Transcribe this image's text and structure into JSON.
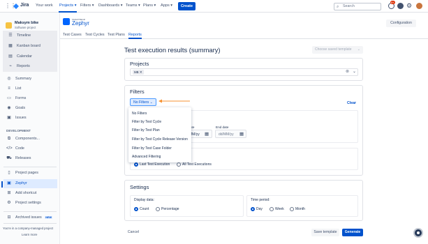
{
  "topnav": {
    "logo": "Jira",
    "your_work": "Your work",
    "projects": "Projects",
    "filters": "Filters",
    "dashboards": "Dashboards",
    "teams": "Teams",
    "plans": "Plans",
    "apps": "Apps",
    "create": "Create",
    "search_placeholder": "Search",
    "notification_count": "9+"
  },
  "sidebar": {
    "project_name": "Maksym bike",
    "project_type": "Software project",
    "planning_items": [
      {
        "label": "Timeline",
        "icon": "timeline-icon"
      },
      {
        "label": "Kanban board",
        "icon": "board-icon"
      },
      {
        "label": "Calendar",
        "icon": "calendar-icon"
      },
      {
        "label": "Reports",
        "icon": "reports-icon"
      }
    ],
    "items": [
      {
        "label": "Summary",
        "icon": "globe-icon"
      },
      {
        "label": "List",
        "icon": "list-icon"
      },
      {
        "label": "Forms",
        "icon": "forms-icon"
      },
      {
        "label": "Goals",
        "icon": "goals-icon"
      },
      {
        "label": "Issues",
        "icon": "issues-icon"
      }
    ],
    "development_heading": "DEVELOPMENT",
    "dev_items": [
      {
        "label": "Components...",
        "icon": "components-icon"
      },
      {
        "label": "Code",
        "icon": "code-icon"
      },
      {
        "label": "Releases",
        "icon": "releases-icon"
      }
    ],
    "bottom_items": [
      {
        "label": "Project pages",
        "icon": "pages-icon"
      },
      {
        "label": "Zephyr",
        "icon": "zephyr-icon"
      },
      {
        "label": "Add shortcut",
        "icon": "add-shortcut-icon"
      },
      {
        "label": "Project settings",
        "icon": "settings-icon"
      }
    ],
    "archived": "Archived issues",
    "archived_badge": "NEW",
    "footer_text": "You're in a company-managed project",
    "learn_more": "Learn more"
  },
  "zephyr": {
    "brand_small": "SMARTBEAR",
    "brand": "Zephyr",
    "configuration": "Configuration",
    "tabs": [
      "Test Cases",
      "Test Cycles",
      "Test Plans",
      "Reports"
    ],
    "active_tab": "Reports"
  },
  "report": {
    "title": "Test execution results (summary)",
    "saved_template_placeholder": "Choose saved template",
    "projects_heading": "Projects",
    "project_tag": "MB",
    "filters_heading": "Filters",
    "filter_button": "No Filters",
    "clear": "Clear",
    "dropdown_options": [
      "No Filters",
      "Filter by Test Cycle",
      "Filter by Test Plan",
      "Filter by Test Cycle Release Version",
      "Filter by Test Case Folder",
      "Advanced Filtering"
    ],
    "start_date_label": "ate",
    "start_date_value": "MM/yy",
    "end_date_label": "End date",
    "end_date_placeholder": "dd/MM/yy",
    "last_test_execution": "Last Test Execution",
    "all_test_executions": "All Test Executions",
    "settings_heading": "Settings",
    "display_data_label": "Display data:",
    "display_options": [
      "Count",
      "Percentage"
    ],
    "time_period_label": "Time period:",
    "time_options": [
      "Day",
      "Week",
      "Month"
    ],
    "cancel": "Cancel",
    "save_template": "Save template",
    "generate": "Generate"
  },
  "colors": {
    "accent": "#0052cc",
    "annotation_arrow": "#f79232"
  }
}
